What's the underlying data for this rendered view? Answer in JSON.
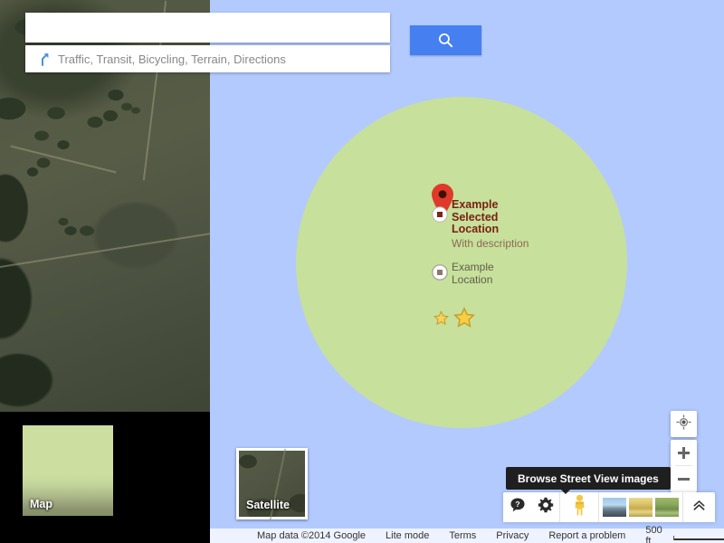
{
  "search": {
    "value": "",
    "placeholder": "",
    "button_icon": "search-icon",
    "suggestion": {
      "icon": "directions-fork-icon",
      "text": "Traffic, Transit, Bicycling, Terrain, Directions"
    }
  },
  "map": {
    "markers": [
      {
        "type": "selected-pin",
        "title": "Example Selected Location",
        "description": "With description"
      },
      {
        "type": "plain-dot",
        "title": "Example Location",
        "description": ""
      }
    ],
    "stars": [
      {
        "name": "star-small"
      },
      {
        "name": "star-large"
      }
    ],
    "colors": {
      "water": "#b3caff",
      "land": "#c7e09c",
      "pin": "#e0392a",
      "selected_label": "#7a1f12",
      "description_label": "#8a6a55",
      "search_button": "#4680f0",
      "star": "#f5c842"
    }
  },
  "basemap_toggles": [
    {
      "label": "Map",
      "selected": true
    },
    {
      "label": "Satellite",
      "selected": false
    }
  ],
  "controls": {
    "my_location": "my-location-icon",
    "zoom_in": "+",
    "zoom_out": "−"
  },
  "bottom_bar": {
    "help_icon": "help-bubble-icon",
    "settings_icon": "gear-icon",
    "pegman_icon": "pegman-streetview-icon",
    "photos": [
      {
        "name": "photo-thumbnail-coast"
      },
      {
        "name": "photo-thumbnail-field"
      },
      {
        "name": "photo-thumbnail-meadow"
      }
    ],
    "expand_icon": "chevron-double-up-icon",
    "tooltip": "Browse Street View images"
  },
  "attribution": {
    "copyright": "Map data ©2014 Google",
    "links": [
      "Lite mode",
      "Terms",
      "Privacy",
      "Report a problem"
    ],
    "scale": "500 ft"
  }
}
